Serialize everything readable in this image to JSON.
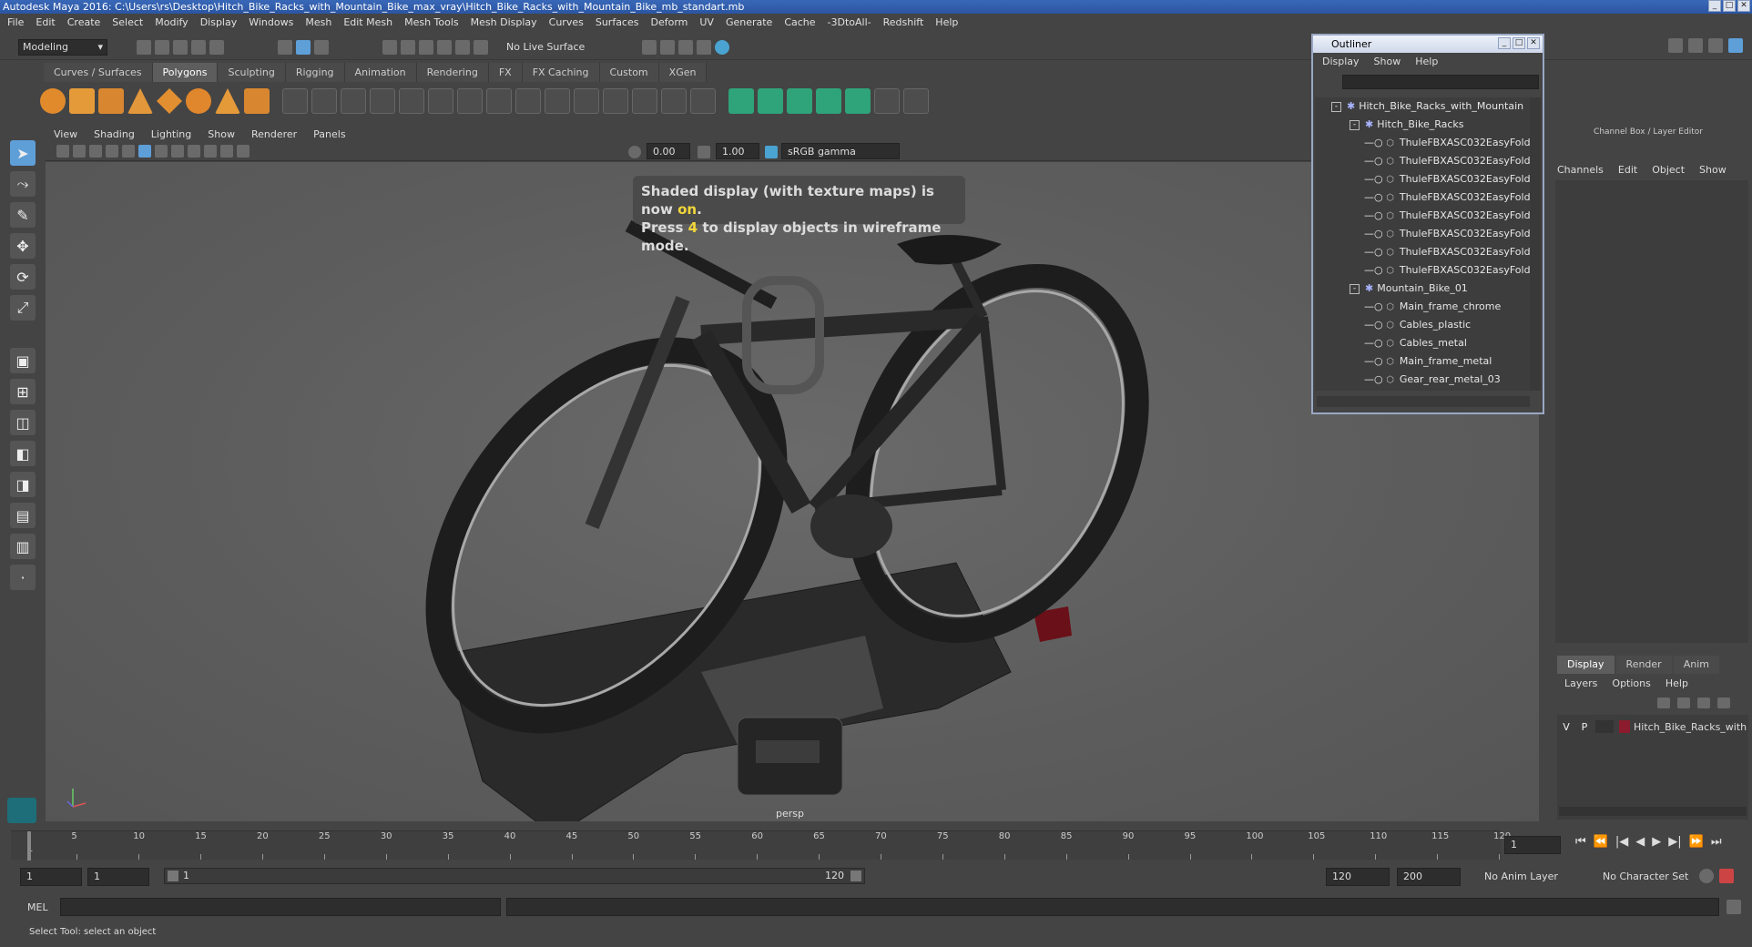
{
  "window": {
    "title": "Autodesk Maya 2016: C:\\Users\\rs\\Desktop\\Hitch_Bike_Racks_with_Mountain_Bike_max_vray\\Hitch_Bike_Racks_with_Mountain_Bike_mb_standart.mb"
  },
  "menubar": [
    "File",
    "Edit",
    "Create",
    "Select",
    "Modify",
    "Display",
    "Windows",
    "Mesh",
    "Edit Mesh",
    "Mesh Tools",
    "Mesh Display",
    "Curves",
    "Surfaces",
    "Deform",
    "UV",
    "Generate",
    "Cache",
    "-3DtoAll-",
    "Redshift",
    "Help"
  ],
  "status": {
    "mode": "Modeling",
    "live_surface": "No Live Surface"
  },
  "shelf_tabs": [
    "Curves / Surfaces",
    "Polygons",
    "Sculpting",
    "Rigging",
    "Animation",
    "Rendering",
    "FX",
    "FX Caching",
    "Custom",
    "XGen"
  ],
  "shelf_active": "Polygons",
  "viewport": {
    "menu": [
      "View",
      "Shading",
      "Lighting",
      "Show",
      "Renderer",
      "Panels"
    ],
    "exposure": "0.00",
    "gamma": "1.00",
    "color_space": "sRGB gamma",
    "hud_line1_prefix": "Shaded display (with texture maps) is now ",
    "hud_line1_highlight": "on",
    "hud_line1_suffix": ".",
    "hud_line2_prefix": "Press ",
    "hud_line2_highlight": "4",
    "hud_line2_suffix": " to display objects in wireframe mode.",
    "camera": "persp"
  },
  "outliner": {
    "title": "Outliner",
    "menu": [
      "Display",
      "Show",
      "Help"
    ],
    "items": [
      {
        "label": "Hitch_Bike_Racks_with_Mountain",
        "level": 0,
        "type": "group",
        "expand": "-"
      },
      {
        "label": "Hitch_Bike_Racks",
        "level": 1,
        "type": "group",
        "expand": "-"
      },
      {
        "label": "ThuleFBXASC032EasyFold",
        "level": 2,
        "type": "mesh"
      },
      {
        "label": "ThuleFBXASC032EasyFold",
        "level": 2,
        "type": "mesh"
      },
      {
        "label": "ThuleFBXASC032EasyFold",
        "level": 2,
        "type": "mesh"
      },
      {
        "label": "ThuleFBXASC032EasyFold",
        "level": 2,
        "type": "mesh"
      },
      {
        "label": "ThuleFBXASC032EasyFold",
        "level": 2,
        "type": "mesh"
      },
      {
        "label": "ThuleFBXASC032EasyFold",
        "level": 2,
        "type": "mesh"
      },
      {
        "label": "ThuleFBXASC032EasyFold",
        "level": 2,
        "type": "mesh"
      },
      {
        "label": "ThuleFBXASC032EasyFold",
        "level": 2,
        "type": "mesh"
      },
      {
        "label": "Mountain_Bike_01",
        "level": 1,
        "type": "group",
        "expand": "-"
      },
      {
        "label": "Main_frame_chrome",
        "level": 2,
        "type": "mesh"
      },
      {
        "label": "Cables_plastic",
        "level": 2,
        "type": "mesh"
      },
      {
        "label": "Cables_metal",
        "level": 2,
        "type": "mesh"
      },
      {
        "label": "Main_frame_metal",
        "level": 2,
        "type": "mesh"
      },
      {
        "label": "Gear_rear_metal_03",
        "level": 2,
        "type": "mesh"
      }
    ]
  },
  "channel_box": {
    "header": "Channel Box / Layer Editor",
    "menu": [
      "Channels",
      "Edit",
      "Object",
      "Show"
    ]
  },
  "layer_editor": {
    "tabs": [
      "Display",
      "Render",
      "Anim"
    ],
    "active_tab": "Display",
    "menu": [
      "Layers",
      "Options",
      "Help"
    ],
    "layer": {
      "v": "V",
      "p": "P",
      "name": "Hitch_Bike_Racks_with",
      "color": "#8a1c2e"
    }
  },
  "timeline": {
    "ticks": [
      "1",
      "5",
      "10",
      "15",
      "20",
      "25",
      "30",
      "35",
      "40",
      "45",
      "50",
      "55",
      "60",
      "65",
      "70",
      "75",
      "80",
      "85",
      "90",
      "95",
      "100",
      "105",
      "110",
      "115",
      "120"
    ],
    "current_frame": "1"
  },
  "range": {
    "start": "1",
    "playback_start": "1",
    "slider_start": "1",
    "slider_end": "120",
    "playback_end": "120",
    "end": "200",
    "anim_layer": "No Anim Layer",
    "character_set": "No Character Set"
  },
  "command": {
    "label": "MEL"
  },
  "help_line": "Select Tool: select an object"
}
